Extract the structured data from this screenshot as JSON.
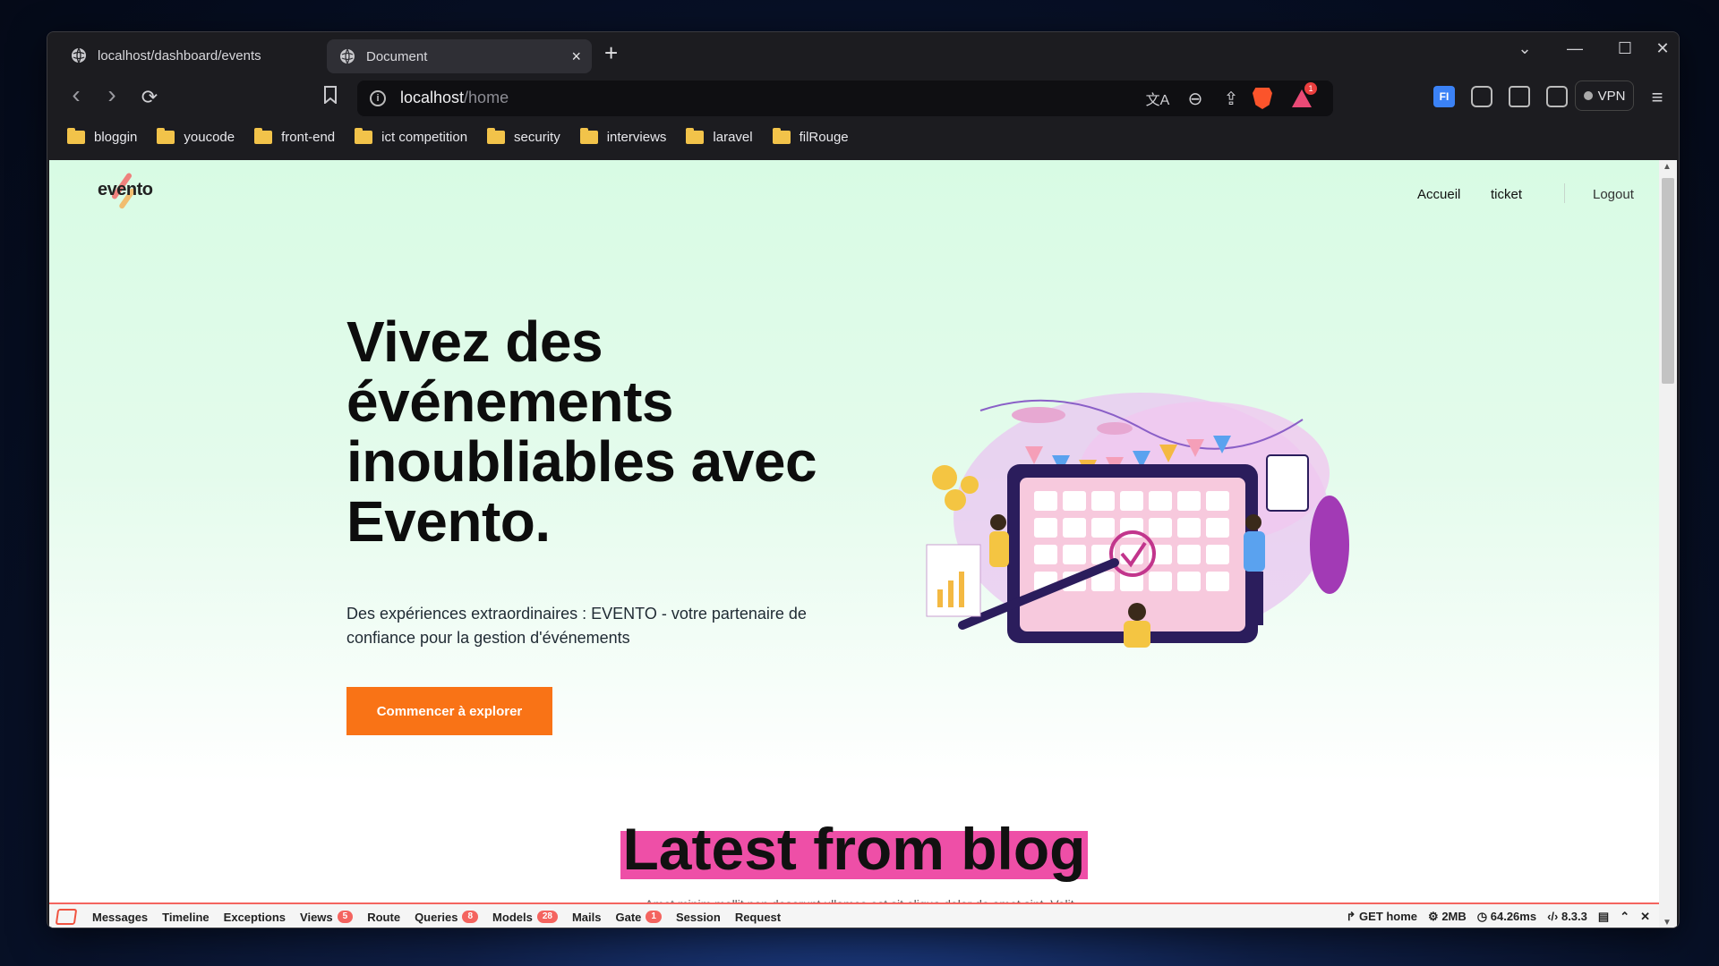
{
  "browser": {
    "tabs": [
      {
        "title": "localhost/dashboard/events"
      },
      {
        "title": "Document",
        "close": "×"
      }
    ],
    "new_tab": "+",
    "window_controls": {
      "list": "⌄",
      "minimize": "—",
      "maximize": "☐",
      "close": "✕"
    },
    "nav": {
      "back": "‹",
      "forward": "›",
      "reload": "⟳",
      "bookmark": "🔖"
    },
    "url": {
      "host": "localhost",
      "path": "/home",
      "info": "i"
    },
    "url_icons": {
      "translate": "文A",
      "zoom": "⊖",
      "share": "⇪"
    },
    "bat_badge": "1",
    "vpn_label": "VPN",
    "menu_icon": "≡",
    "bookmarks": [
      "bloggin",
      "youcode",
      "front-end",
      "ict competition",
      "security",
      "interviews",
      "laravel",
      "filRouge"
    ]
  },
  "site": {
    "logo": "evento",
    "nav": {
      "home": "Accueil",
      "ticket": "ticket",
      "logout": "Logout"
    },
    "hero": {
      "title_line1": "Vivez des",
      "title_line2": "événements",
      "title_line3": "inoubliables avec",
      "title_highlight": "Evento.",
      "lead": "Des expériences extraordinaires : EVENTO - votre partenaire de confiance pour la gestion d'événements",
      "cta": "Commencer à explorer"
    },
    "blog": {
      "title": "Latest from blog",
      "subtitle": "Amet minim mollit non deserunt ullamco est sit aliqua dolor do amet sint. Velit officia consequat duis."
    }
  },
  "debugbar": {
    "items": [
      {
        "label": "Messages"
      },
      {
        "label": "Timeline"
      },
      {
        "label": "Exceptions"
      },
      {
        "label": "Views",
        "badge": "5"
      },
      {
        "label": "Route"
      },
      {
        "label": "Queries",
        "badge": "8"
      },
      {
        "label": "Models",
        "badge": "28"
      },
      {
        "label": "Mails"
      },
      {
        "label": "Gate",
        "badge": "1"
      },
      {
        "label": "Session"
      },
      {
        "label": "Request"
      }
    ],
    "route": "GET home",
    "memory": "2MB",
    "time": "64.26ms",
    "php": "8.3.3"
  },
  "colors": {
    "accent": "#f97316",
    "highlight_green": "#4fd686",
    "highlight_pink": "#ee4fa7",
    "hero_bg": "#d8fbe4",
    "debug_red": "#f4645f"
  }
}
